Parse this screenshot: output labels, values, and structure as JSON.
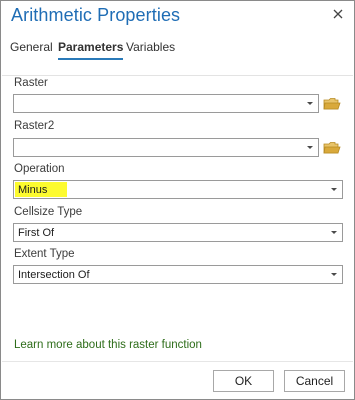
{
  "window": {
    "title": "Arithmetic Properties"
  },
  "tabs": [
    {
      "label": "General",
      "active": false
    },
    {
      "label": "Parameters",
      "active": true
    },
    {
      "label": "Variables",
      "active": false
    }
  ],
  "fields": {
    "raster": {
      "label": "Raster",
      "value": ""
    },
    "raster2": {
      "label": "Raster2",
      "value": ""
    },
    "operation": {
      "label": "Operation",
      "value": "Minus",
      "highlight_color": "#fdfb2f"
    },
    "cellsize_type": {
      "label": "Cellsize Type",
      "value": "First Of"
    },
    "extent_type": {
      "label": "Extent Type",
      "value": "Intersection Of"
    }
  },
  "link": {
    "text": "Learn more about this raster function"
  },
  "buttons": {
    "ok": "OK",
    "cancel": "Cancel"
  },
  "icons": {
    "close": "close-icon",
    "folder": "folder-icon",
    "dropdown": "chevron-down-icon"
  },
  "colors": {
    "title": "#1f6db5",
    "tab_underline": "#2a7ab9",
    "link": "#2e6d1a",
    "folder": "#d9a93b"
  }
}
